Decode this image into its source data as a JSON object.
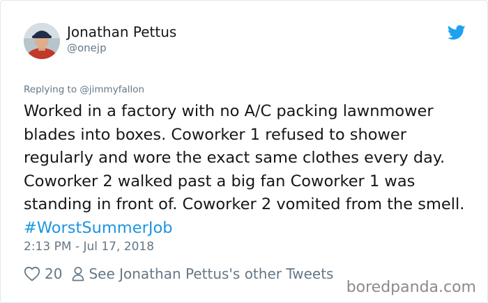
{
  "author": {
    "display_name": "Jonathan Pettus",
    "handle": "@onejp"
  },
  "icons": {
    "brand": "twitter-bird-icon",
    "like": "heart-icon",
    "profile": "person-icon"
  },
  "colors": {
    "brand": "#1da1f2",
    "hashtag": "#1b95e0",
    "secondary_text": "#657786"
  },
  "reply": {
    "prefix": "Replying to",
    "mention": "@jimmyfallon"
  },
  "tweet": {
    "body": "Worked in a factory with no A/C packing lawnmower blades into boxes. Coworker 1 refused to shower regularly and wore the exact same clothes every day. Coworker 2 walked past a big fan Coworker 1 was standing in front of. Coworker 2 vomited from the smell.",
    "hashtag": "#WorstSummerJob",
    "timestamp": "2:13 PM - Jul 17, 2018"
  },
  "actions": {
    "like_count": "20",
    "other_tweets_label": "See Jonathan Pettus's other Tweets"
  },
  "watermark": "boredpanda.com"
}
